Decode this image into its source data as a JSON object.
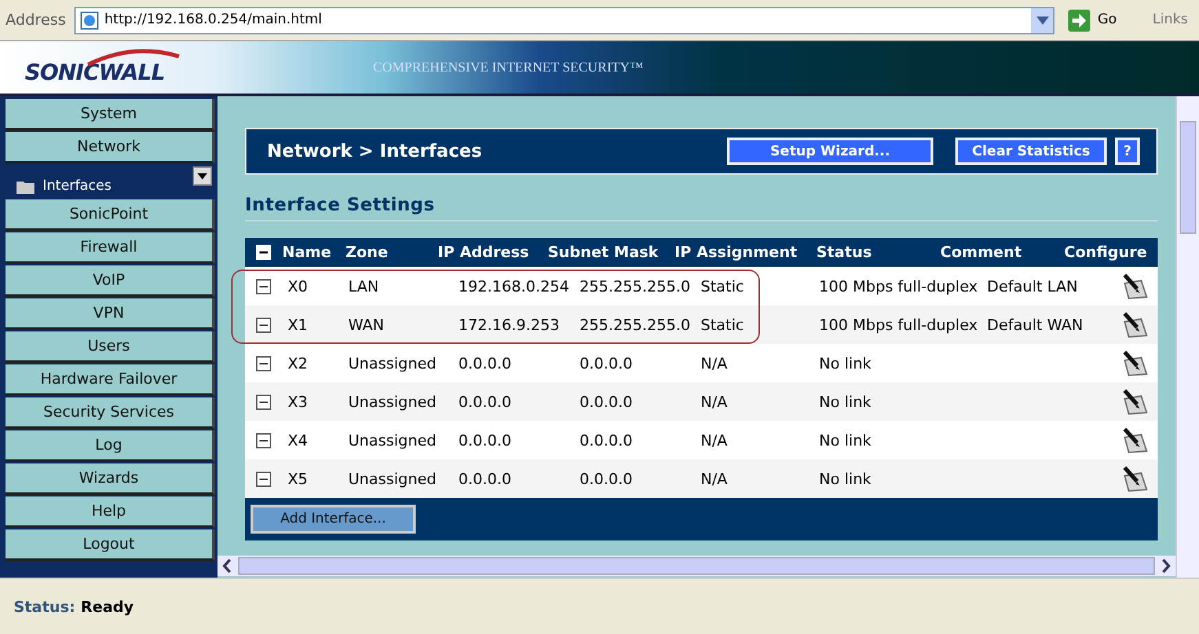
{
  "address_bar": {
    "label": "Address",
    "url": "http://192.168.0.254/main.html",
    "go": "Go",
    "links": "Links"
  },
  "banner": {
    "logo": "SONICWALL",
    "tagline": "COMPREHENSIVE INTERNET SECURITY™"
  },
  "sidebar": {
    "items": [
      {
        "label": "System"
      },
      {
        "label": "Network",
        "children": [
          {
            "label": "Interfaces",
            "selected": true
          }
        ]
      },
      {
        "label": "SonicPoint"
      },
      {
        "label": "Firewall"
      },
      {
        "label": "VoIP"
      },
      {
        "label": "VPN"
      },
      {
        "label": "Users"
      },
      {
        "label": "Hardware Failover"
      },
      {
        "label": "Security Services"
      },
      {
        "label": "Log"
      },
      {
        "label": "Wizards"
      },
      {
        "label": "Help"
      },
      {
        "label": "Logout"
      }
    ]
  },
  "header": {
    "title": "Network > Interfaces",
    "buttons": [
      "Setup Wizard...",
      "Clear Statistics"
    ],
    "help": "?"
  },
  "section_title": "Interface Settings",
  "table": {
    "columns": [
      "Name",
      "Zone",
      "IP Address",
      "Subnet Mask",
      "IP Assignment",
      "Status",
      "Comment",
      "Configure"
    ],
    "rows": [
      {
        "cells": [
          "X0",
          "LAN",
          "192.168.0.254",
          "255.255.255.0",
          "Static",
          "100 Mbps full-duplex",
          "Default LAN"
        ]
      },
      {
        "cells": [
          "X1",
          "WAN",
          "172.16.9.253",
          "255.255.255.0",
          "Static",
          "100 Mbps full-duplex",
          "Default WAN"
        ]
      },
      {
        "cells": [
          "X2",
          "Unassigned",
          "0.0.0.0",
          "0.0.0.0",
          "N/A",
          "No link"
        ]
      },
      {
        "cells": [
          "X3",
          "Unassigned",
          "0.0.0.0",
          "0.0.0.0",
          "N/A",
          "No link"
        ]
      },
      {
        "cells": [
          "X4",
          "Unassigned",
          "0.0.0.0",
          "0.0.0.0",
          "N/A",
          "No link"
        ]
      },
      {
        "cells": [
          "X5",
          "Unassigned",
          "0.0.0.0",
          "0.0.0.0",
          "N/A",
          "No link"
        ]
      }
    ],
    "add_button": "Add Interface..."
  },
  "status_bar": {
    "label": "Status:",
    "value": "Ready"
  }
}
